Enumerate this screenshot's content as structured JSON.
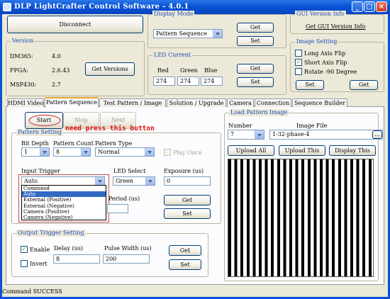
{
  "window": {
    "title": "DLP LightCrafter Control Software - 4.0.1",
    "controls": {
      "minimize": "_",
      "maximize": "□",
      "close": "×"
    }
  },
  "connection": {
    "disconnect_label": "Disconnect"
  },
  "version": {
    "legend": "Version",
    "rows": [
      {
        "label": "DM365:",
        "value": "4.0"
      },
      {
        "label": "FPGA:",
        "value": "2.6.43"
      },
      {
        "label": "MSP430:",
        "value": "2.7"
      }
    ],
    "get_versions_label": "Get Versions"
  },
  "display_mode": {
    "legend": "Display Mode",
    "selected": "Pattern Sequence",
    "get_label": "Get",
    "set_label": "Set"
  },
  "led_current": {
    "legend": "LED Current",
    "headers": [
      "Red",
      "Green",
      "Blue"
    ],
    "values": [
      "274",
      "274",
      "274"
    ],
    "get_label": "Get",
    "set_label": "Set"
  },
  "gui_version": {
    "legend": "GUI Version Info",
    "button_label": "Get GUI Version Info"
  },
  "image_setting": {
    "legend": "Image Setting",
    "options": [
      {
        "label": "Long Axis Flip",
        "checked": false
      },
      {
        "label": "Short Axis Flip",
        "checked": true
      },
      {
        "label": "Rotate -90 Degree",
        "checked": false
      }
    ],
    "set_label": "Set",
    "get_label": "Get"
  },
  "tabs": [
    {
      "label": "HDMI Video",
      "active": false
    },
    {
      "label": "Pattern Sequence",
      "active": true
    },
    {
      "label": "Test Pattern / Image",
      "active": false
    },
    {
      "label": "Solution / Upgrade",
      "active": false
    },
    {
      "label": "Camera",
      "active": false
    },
    {
      "label": "Connection",
      "active": false
    },
    {
      "label": "Sequence Builder",
      "active": false
    }
  ],
  "sequence_controls": {
    "start_label": "Start",
    "stop_label": "Stop",
    "next_label": "Next"
  },
  "annotation": {
    "text": "need press this button",
    "color": "#e01010"
  },
  "pattern_setting": {
    "legend": "Pattern Setting",
    "bit_depth_label": "Bit Depth",
    "bit_depth_value": "1",
    "pattern_count_label": "Pattern Count",
    "pattern_count_value": "8",
    "pattern_type_label": "Pattern Type",
    "pattern_type_value": "Normal",
    "play_once_label": "Play Once",
    "input_trigger_label": "Input Trigger",
    "input_trigger_value": "Auto",
    "input_trigger_options": [
      "Command",
      "Auto",
      "External (Positive)",
      "External (Negative)",
      "Camera (Positive)",
      "Camera (Negative)"
    ],
    "input_trigger_highlighted": "Auto",
    "led_select_label": "LED Select",
    "led_select_value": "Green",
    "exposure_label": "Exposure (us)",
    "exposure_value": "0",
    "period_label": "Period (us)",
    "period_value": "",
    "get_label": "Get",
    "set_label": "Set"
  },
  "output_trigger": {
    "legend": "Output Trigger Setting",
    "enable_label": "Enable",
    "enable_checked": true,
    "invert_label": "Invert",
    "invert_checked": false,
    "delay_label": "Delay (us)",
    "delay_value": "8",
    "pulse_width_label": "Pulse Width (us)",
    "pulse_width_value": "200",
    "get_label": "Get",
    "set_label": "Set"
  },
  "load_pattern": {
    "legend": "Load Pattern Image",
    "number_label": "Number",
    "number_value": "7",
    "image_file_label": "Image File",
    "image_file_value": "1-32-phase-4",
    "browse_label": "...",
    "upload_all_label": "Upload All",
    "upload_this_label": "Upload This",
    "display_this_label": "Display This"
  },
  "status": {
    "text": "Command SUCCESS"
  },
  "colors": {
    "accent": "#0a52d6",
    "legend": "#1a4bb8",
    "annotation": "#e01010",
    "selection": "#316ac5"
  }
}
